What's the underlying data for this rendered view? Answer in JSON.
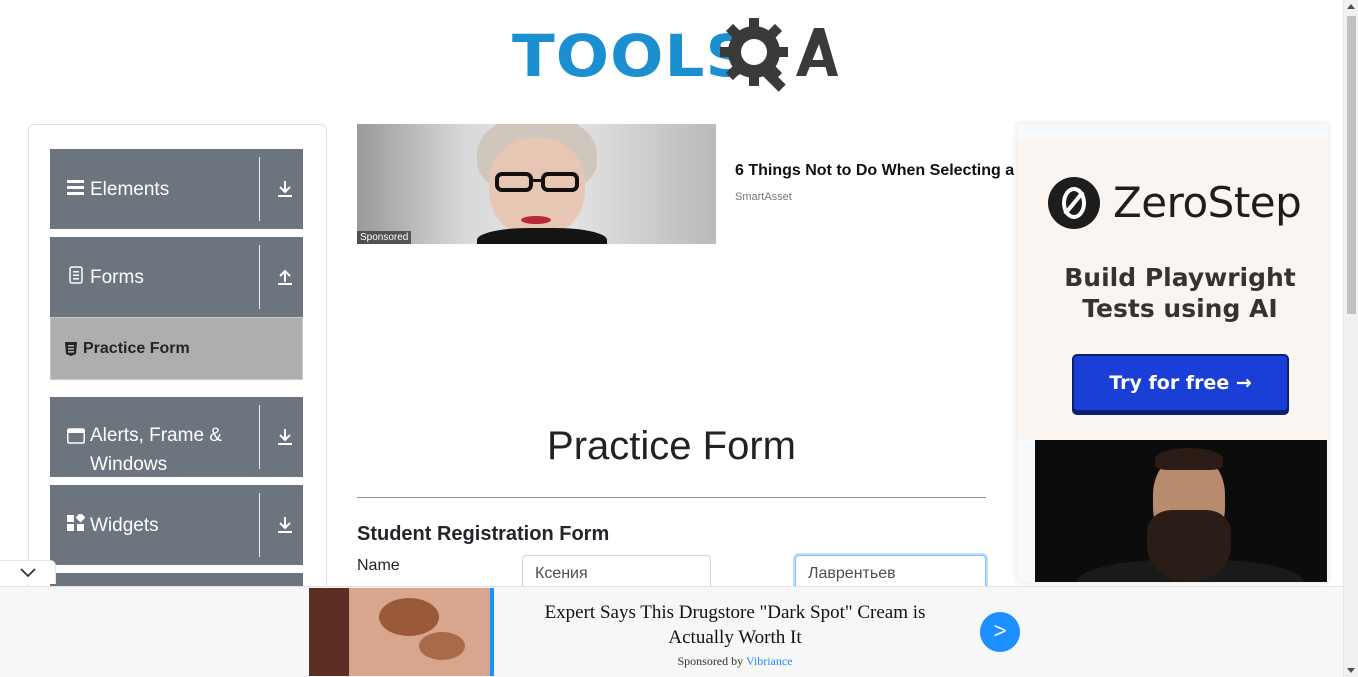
{
  "header": {
    "logo_text": "TOOLS",
    "logo_suffix": "A"
  },
  "sidebar": {
    "groups": [
      {
        "label": "Elements",
        "icon": "menu-icon",
        "toggle": "download-icon"
      },
      {
        "label": "Forms",
        "icon": "document-icon",
        "toggle": "upload-icon"
      },
      {
        "label": "Alerts, Frame & Windows",
        "icon": "window-icon",
        "toggle": "download-icon"
      },
      {
        "label": "Widgets",
        "icon": "widgets-icon",
        "toggle": "download-icon"
      }
    ],
    "active_item": {
      "label": "Practice Form",
      "icon": "html5-icon"
    }
  },
  "top_ad": {
    "headline": "6 Things Not to Do When Selecting a",
    "source": "SmartAsset",
    "sponsored": "Sponsored"
  },
  "main": {
    "title": "Practice Form",
    "form_title": "Student Registration Form",
    "name_label": "Name",
    "first_name_value": "Ксения",
    "last_name_value": "Лаврентьев"
  },
  "right_ad": {
    "brand": "ZeroStep",
    "tagline_line1": "Build Playwright",
    "tagline_line2": "Tests using AI",
    "cta": "Try for free →"
  },
  "bottom_ad": {
    "headline": "Expert Says This Drugstore \"Dark Spot\" Cream is Actually Worth It",
    "sponsored_prefix": "Sponsored by",
    "sponsor": "Vibriance",
    "go_label": ">"
  },
  "colors": {
    "brand_blue": "#1b8fd0",
    "sidebar_grey": "#6c757d",
    "active_item_bg": "#aeaeae",
    "cta_blue": "#1a3fd6",
    "accent_blue": "#1e8fff"
  }
}
